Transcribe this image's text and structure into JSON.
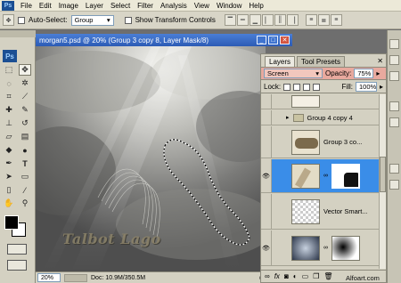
{
  "menu": [
    "File",
    "Edit",
    "Image",
    "Layer",
    "Select",
    "Filter",
    "Analysis",
    "View",
    "Window",
    "Help"
  ],
  "app_badge": "Ps",
  "options": {
    "auto_select_label": "Auto-Select:",
    "auto_select_value": "Group",
    "show_transform_label": "Show Transform Controls"
  },
  "document": {
    "title": "morgan5.psd @ 20% (Group 3 copy 8, Layer Mask/8)",
    "canvas_text": "Talbot Lago",
    "status": "Doc: 10.9M/350.5M",
    "zoom": "20%"
  },
  "layers_panel": {
    "tabs": [
      "Layers",
      "Tool Presets"
    ],
    "blend_mode": "Screen",
    "opacity_label": "Opacity:",
    "opacity_value": "75%",
    "lock_label": "Lock:",
    "fill_label": "Fill:",
    "fill_value": "100%",
    "layers": [
      {
        "name": ""
      },
      {
        "name": "Group 4 copy 4"
      },
      {
        "name": "Group 3 co..."
      },
      {
        "name": ""
      },
      {
        "name": "Vector Smart..."
      },
      {
        "name": ""
      }
    ]
  },
  "watermark": "Alfoart.com",
  "colors": {
    "selection": "#3a8de8",
    "title_bar": "#2c5bb5",
    "menu_bg": "#ece9d8",
    "panel_bg": "#d4d1c2"
  }
}
